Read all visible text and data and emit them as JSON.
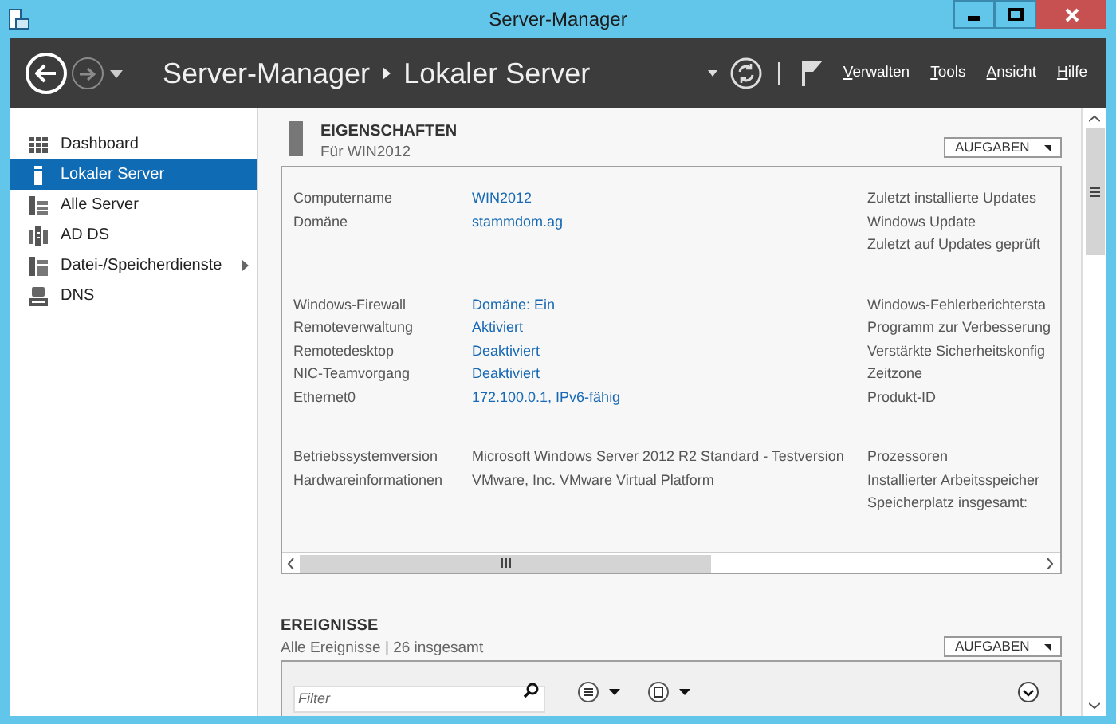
{
  "window": {
    "title": "Server-Manager"
  },
  "header": {
    "breadcrumb": [
      "Server-Manager",
      "Lokaler Server"
    ],
    "menu": [
      "Verwalten",
      "Tools",
      "Ansicht",
      "Hilfe"
    ]
  },
  "sidebar": {
    "items": [
      {
        "label": "Dashboard",
        "kind": "dashboard",
        "selected": false,
        "has_submenu": false
      },
      {
        "label": "Lokaler Server",
        "kind": "server",
        "selected": true,
        "has_submenu": false
      },
      {
        "label": "Alle Server",
        "kind": "servers",
        "selected": false,
        "has_submenu": false
      },
      {
        "label": "AD DS",
        "kind": "adds",
        "selected": false,
        "has_submenu": false
      },
      {
        "label": "Datei-/Speicherdienste",
        "kind": "storage",
        "selected": false,
        "has_submenu": true
      },
      {
        "label": "DNS",
        "kind": "dns",
        "selected": false,
        "has_submenu": false
      }
    ]
  },
  "properties": {
    "title": "EIGENSCHAFTEN",
    "subtitle": "Für WIN2012",
    "tasks_button": "AUFGABEN",
    "groups": [
      {
        "rows": [
          {
            "label": "Computername",
            "value": "WIN2012",
            "link": true,
            "aside": "Zuletzt installierte Updates"
          },
          {
            "label": "Domäne",
            "value": "stammdom.ag",
            "link": true,
            "aside": "Windows Update"
          },
          {
            "aside": "Zuletzt auf Updates geprüft"
          }
        ]
      },
      {
        "rows": [
          {
            "label": "Windows-Firewall",
            "value": "Domäne: Ein",
            "link": true,
            "aside": "Windows-Fehlerberichtersta"
          },
          {
            "label": "Remoteverwaltung",
            "value": "Aktiviert",
            "link": true,
            "aside": "Programm zur Verbesserung"
          },
          {
            "label": "Remotedesktop",
            "value": "Deaktiviert",
            "link": true,
            "aside": "Verstärkte Sicherheitskonfig"
          },
          {
            "label": "NIC-Teamvorgang",
            "value": "Deaktiviert",
            "link": true,
            "aside": "Zeitzone"
          },
          {
            "label": "Ethernet0",
            "value": "172.100.0.1, IPv6-fähig",
            "link": true,
            "aside": "Produkt-ID"
          }
        ]
      },
      {
        "rows": [
          {
            "label": "Betriebssystemversion",
            "value": "Microsoft Windows Server 2012 R2 Standard - Testversion",
            "link": false,
            "aside": "Prozessoren"
          },
          {
            "label": "Hardwareinformationen",
            "value": "VMware, Inc. VMware Virtual Platform",
            "link": false,
            "aside": "Installierter Arbeitsspeicher"
          },
          {
            "aside": "Speicherplatz insgesamt:"
          }
        ]
      }
    ]
  },
  "events": {
    "title": "EREIGNISSE",
    "subtitle": "Alle Ereignisse | 26 insgesamt",
    "tasks_button": "AUFGABEN",
    "filter": {
      "placeholder": "Filter"
    }
  }
}
